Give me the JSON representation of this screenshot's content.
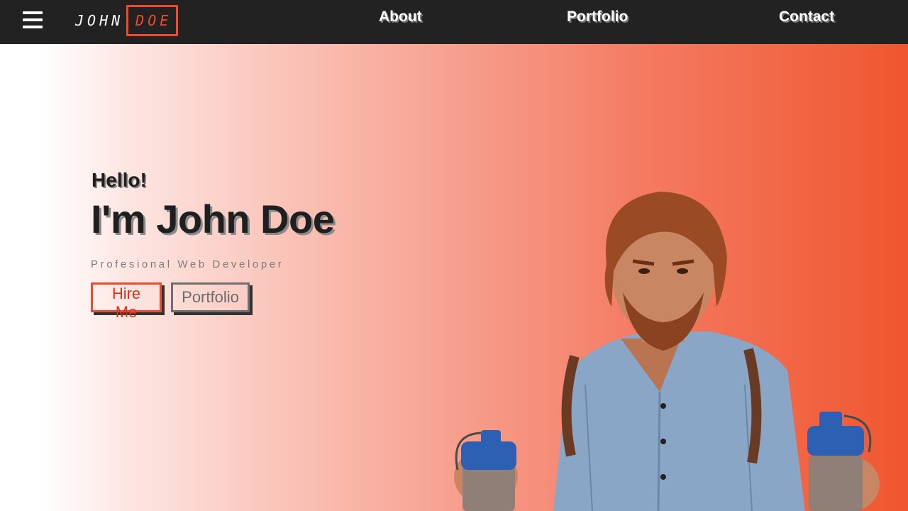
{
  "header": {
    "logo_first": "JOHN",
    "logo_last": "DOE",
    "nav": {
      "about": "About",
      "portfolio": "Portfolio",
      "contact": "Contact"
    }
  },
  "hero": {
    "greeting": "Hello!",
    "name": "I'm John Doe",
    "subtitle": "Profesional Web Developer",
    "hire_button": "Hire Me",
    "portfolio_button": "Portfolio"
  },
  "colors": {
    "accent": "#ee4b2b",
    "header_bg": "#222222",
    "gradient_end": "#f0562f"
  },
  "icons": {
    "menu": "hamburger-menu-icon"
  }
}
